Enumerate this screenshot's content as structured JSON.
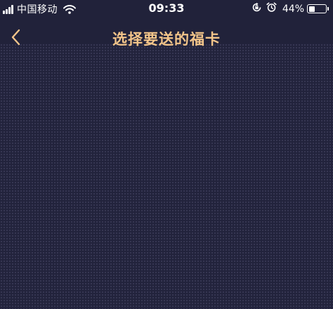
{
  "status_bar": {
    "carrier": "中国移动",
    "time": "09:33",
    "battery_percent": "44%",
    "battery_level": 0.44,
    "icons": [
      "signal-icon",
      "wifi-icon",
      "orientation-lock-icon",
      "alarm-icon",
      "battery-icon"
    ]
  },
  "nav": {
    "back_icon": "chevron-left-icon",
    "title": "选择要送的福卡"
  },
  "colors": {
    "background": "#21223a",
    "title": "#f3c58a",
    "status_text": "#ffffff"
  }
}
